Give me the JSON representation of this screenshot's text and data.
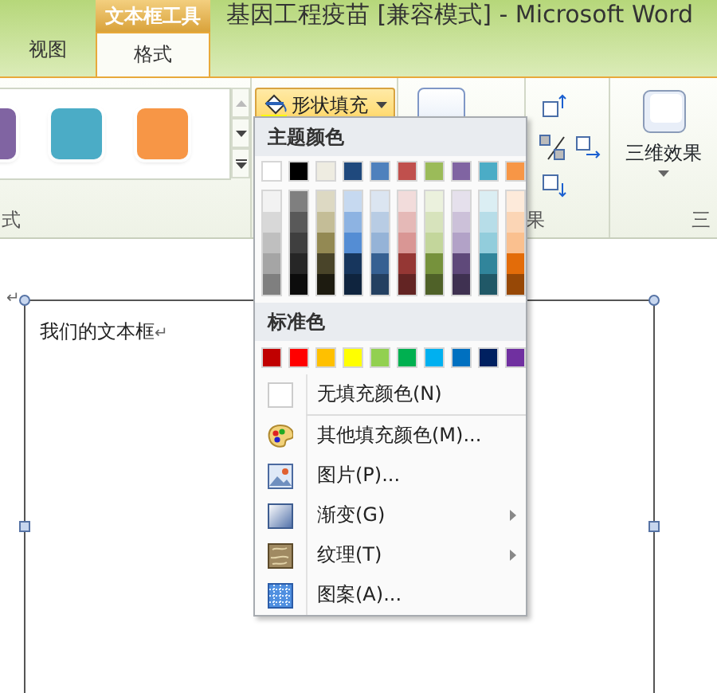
{
  "window": {
    "title": "基因工程疫苗 [兼容模式] - Microsoft Word"
  },
  "contextual_tab_group": "文本框工具",
  "tabs": [
    {
      "label": "视图",
      "selected": false
    },
    {
      "label": "格式",
      "selected": true
    }
  ],
  "ribbon": {
    "style_gallery": [
      {
        "color": "#8064a2"
      },
      {
        "color": "#4bacc6"
      },
      {
        "color": "#f79646"
      }
    ],
    "style_group_label": "式",
    "shape_fill_button": {
      "label": "形状填充",
      "expanded": true
    },
    "arrange_group_label": "果",
    "effects_button": {
      "label": "三维效果"
    },
    "effects_group_label": "三"
  },
  "fill_menu": {
    "theme_header": "主题颜色",
    "theme_colors": [
      {
        "color": "#ffffff",
        "shades": [
          {
            "color": "#f2f2f2"
          },
          {
            "color": "#d8d8d8"
          },
          {
            "color": "#bfbfbf"
          },
          {
            "color": "#a5a5a5"
          },
          {
            "color": "#7f7f7f"
          }
        ]
      },
      {
        "color": "#000000",
        "shades": [
          {
            "color": "#7f7f7f"
          },
          {
            "color": "#595959"
          },
          {
            "color": "#3f3f3f"
          },
          {
            "color": "#262626"
          },
          {
            "color": "#0c0c0c"
          }
        ]
      },
      {
        "color": "#eeece1",
        "shades": [
          {
            "color": "#ddd9c3"
          },
          {
            "color": "#c4bd97"
          },
          {
            "color": "#938953"
          },
          {
            "color": "#494429"
          },
          {
            "color": "#1d1b10"
          }
        ]
      },
      {
        "color": "#1f497d",
        "shades": [
          {
            "color": "#c6d9f0"
          },
          {
            "color": "#8db3e2"
          },
          {
            "color": "#548dd4"
          },
          {
            "color": "#17365d"
          },
          {
            "color": "#0f243e"
          }
        ]
      },
      {
        "color": "#4f81bd",
        "shades": [
          {
            "color": "#dbe5f1"
          },
          {
            "color": "#b8cce4"
          },
          {
            "color": "#95b3d7"
          },
          {
            "color": "#366092"
          },
          {
            "color": "#244061"
          }
        ]
      },
      {
        "color": "#c0504d",
        "shades": [
          {
            "color": "#f2dcdb"
          },
          {
            "color": "#e5b9b7"
          },
          {
            "color": "#d99694"
          },
          {
            "color": "#953734"
          },
          {
            "color": "#632423"
          }
        ]
      },
      {
        "color": "#9bbb59",
        "shades": [
          {
            "color": "#ebf1dd"
          },
          {
            "color": "#d7e3bc"
          },
          {
            "color": "#c3d69b"
          },
          {
            "color": "#76923c"
          },
          {
            "color": "#4f6128"
          }
        ]
      },
      {
        "color": "#8064a2",
        "shades": [
          {
            "color": "#e5e0ec"
          },
          {
            "color": "#ccc1d9"
          },
          {
            "color": "#b2a2c7"
          },
          {
            "color": "#5f497a"
          },
          {
            "color": "#3f3151"
          }
        ]
      },
      {
        "color": "#4bacc6",
        "shades": [
          {
            "color": "#dbeef3"
          },
          {
            "color": "#b7dde8"
          },
          {
            "color": "#92cddc"
          },
          {
            "color": "#31859b"
          },
          {
            "color": "#205867"
          }
        ]
      },
      {
        "color": "#f79646",
        "shades": [
          {
            "color": "#fdeada"
          },
          {
            "color": "#fbd5b5"
          },
          {
            "color": "#fac08f"
          },
          {
            "color": "#e36c09"
          },
          {
            "color": "#974806"
          }
        ]
      }
    ],
    "standard_header": "标准色",
    "standard_colors": [
      {
        "color": "#c00000"
      },
      {
        "color": "#ff0000"
      },
      {
        "color": "#ffc000"
      },
      {
        "color": "#ffff00"
      },
      {
        "color": "#92d050"
      },
      {
        "color": "#00b050"
      },
      {
        "color": "#00b0f0"
      },
      {
        "color": "#0070c0"
      },
      {
        "color": "#002060"
      },
      {
        "color": "#7030a0"
      }
    ],
    "items": [
      {
        "kind": "no_fill",
        "label": "无填充颜色(N)",
        "submenu": false
      },
      {
        "kind": "more_colors",
        "label": "其他填充颜色(M)...",
        "submenu": false
      },
      {
        "kind": "picture",
        "label": "图片(P)...",
        "submenu": false
      },
      {
        "kind": "gradient",
        "label": "渐变(G)",
        "submenu": true
      },
      {
        "kind": "texture",
        "label": "纹理(T)",
        "submenu": true
      },
      {
        "kind": "pattern",
        "label": "图案(A)...",
        "submenu": false
      }
    ]
  },
  "document": {
    "paragraph_mark": "↵",
    "textbox_text": "我们的文本框",
    "textbox_mark": "↵"
  }
}
